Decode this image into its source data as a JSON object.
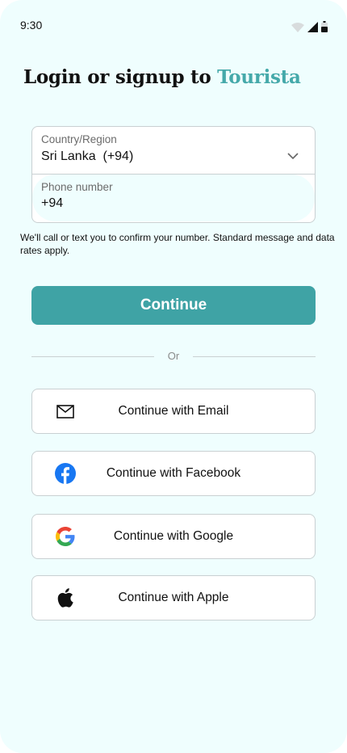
{
  "status_bar": {
    "time": "9:30"
  },
  "header": {
    "title_prefix": "Login or signup to ",
    "brand": "Tourista"
  },
  "form": {
    "country": {
      "label": "Country/Region",
      "value": "Sri Lanka  (+94)"
    },
    "phone": {
      "label": "Phone number",
      "value": "+94"
    }
  },
  "note": "We'll call or text you to confirm your number. Standard message and data rates apply.",
  "continue_label": "Continue",
  "divider_text": "Or",
  "social": {
    "email": "Continue with Email",
    "facebook": "Continue with Facebook",
    "google": "Continue with Google",
    "apple": "Continue with Apple"
  },
  "colors": {
    "background": "#effefe",
    "accent": "#3fa3a5",
    "brand_text": "#45a9aa",
    "facebook_blue": "#1877f2"
  },
  "icons": [
    "wifi-icon",
    "signal-icon",
    "battery-icon",
    "chevron-down-icon",
    "mail-icon",
    "facebook-icon",
    "google-icon",
    "apple-icon"
  ]
}
